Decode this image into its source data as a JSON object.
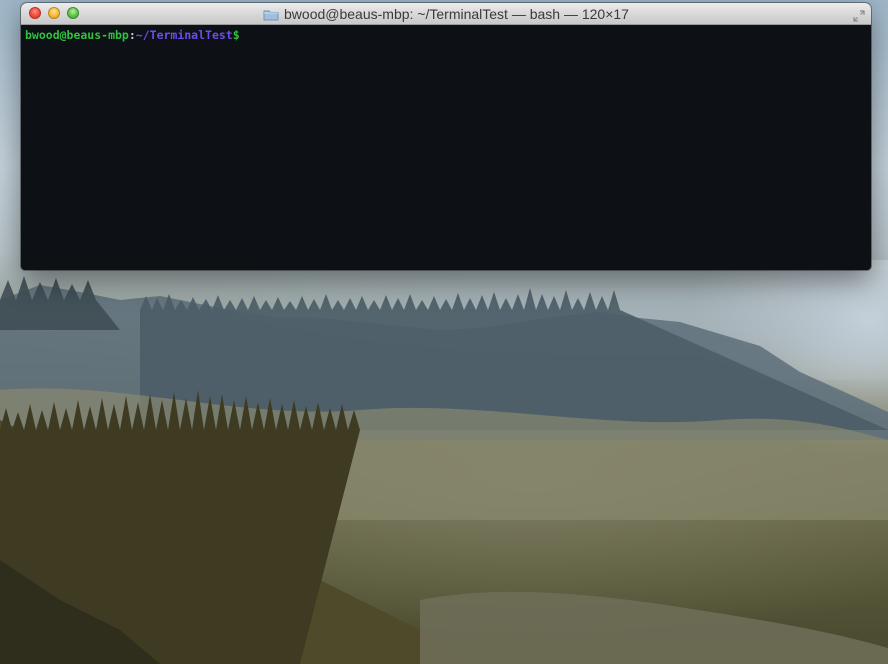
{
  "window": {
    "title": "bwood@beaus-mbp: ~/TerminalTest — bash — 120×17",
    "title_icon": "folder-icon",
    "controls": {
      "close_icon": "close-icon",
      "minimize_icon": "minimize-icon",
      "maximize_icon": "maximize-icon",
      "fullscreen_icon": "fullscreen-icon"
    }
  },
  "terminal": {
    "prompt": {
      "user_host": "bwood@beaus-mbp",
      "separator": ":",
      "path": "~/TerminalTest",
      "symbol": "$"
    },
    "colors": {
      "background": "#0d1014",
      "user_host": "#2fc13f",
      "path": "#6a4df0"
    }
  },
  "desktop": {
    "wallpaper": "misty forested hills"
  }
}
